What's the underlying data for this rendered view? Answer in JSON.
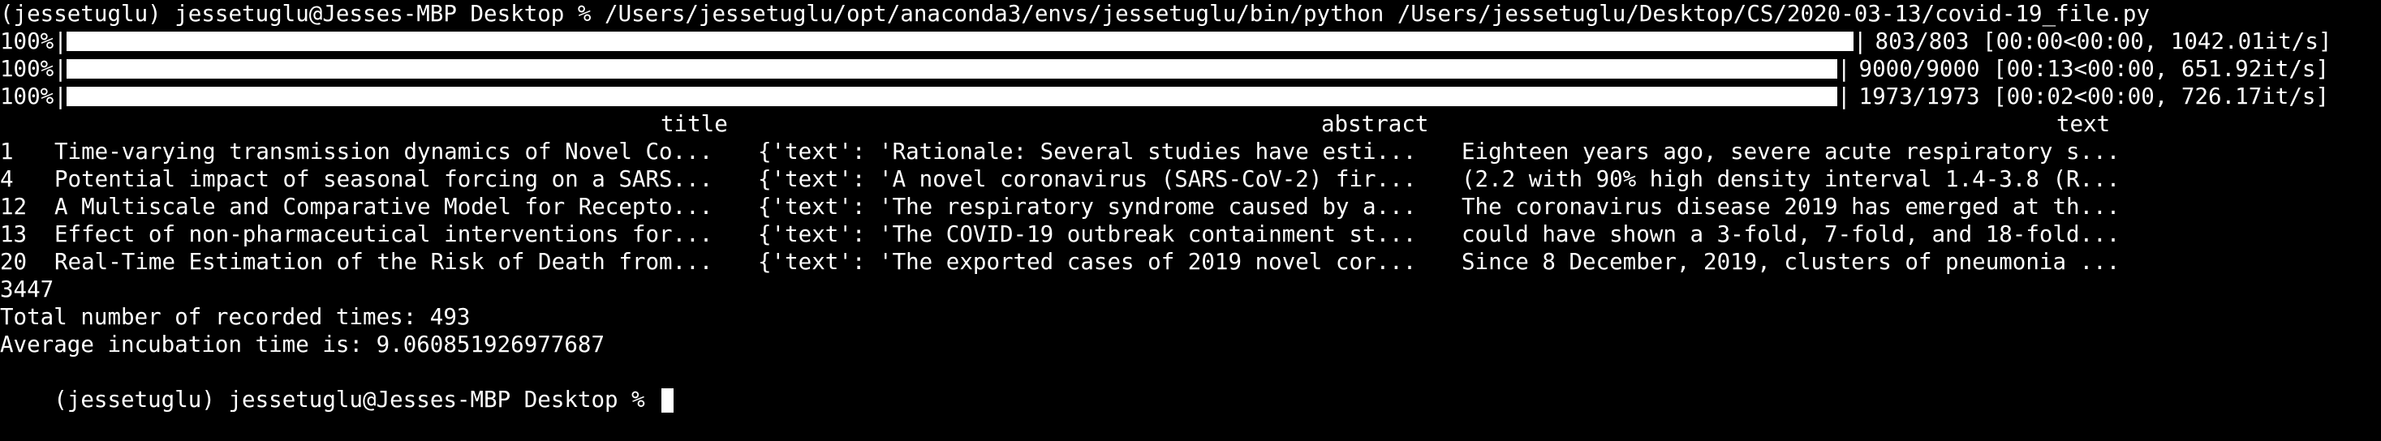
{
  "command_line": "(jessetuglu) jessetuglu@Jesses-MBP Desktop % /Users/jessetuglu/opt/anaconda3/envs/jessetuglu/bin/python /Users/jessetuglu/Desktop/CS/2020-03-13/covid-19_file.py",
  "progress_bars": [
    {
      "percent_label": "100%|",
      "fraction": 1.0,
      "end_char": "|",
      "stats": " 803/803 [00:00<00:00, 1042.01it/s]"
    },
    {
      "percent_label": "100%|",
      "fraction": 1.0,
      "end_char": "|",
      "stats": " 9000/9000 [00:13<00:00, 651.92it/s]"
    },
    {
      "percent_label": "100%|",
      "fraction": 1.0,
      "end_char": "|",
      "stats": " 1973/1973 [00:02<00:00, 726.17it/s]"
    }
  ],
  "table": {
    "headers": [
      "title",
      "abstract",
      "text"
    ],
    "rows": [
      {
        "index": "1",
        "title": "Time-varying transmission dynamics of Novel Co...",
        "abstract": "{'text': 'Rationale: Several studies have esti...",
        "text": "Eighteen years ago, severe acute respiratory s..."
      },
      {
        "index": "4",
        "title": "Potential impact of seasonal forcing on a SARS...",
        "abstract": "{'text': 'A novel coronavirus (SARS-CoV-2) fir...",
        "text": "(2.2 with 90% high density interval 1.4-3.8 (R..."
      },
      {
        "index": "12",
        "title": "A Multiscale and Comparative Model for Recepto...",
        "abstract": "{'text': 'The respiratory syndrome caused by a...",
        "text": "The coronavirus disease 2019 has emerged at th..."
      },
      {
        "index": "13",
        "title": "Effect of non-pharmaceutical interventions for...",
        "abstract": "{'text': 'The COVID-19 outbreak containment st...",
        "text": "could have shown a 3-fold, 7-fold, and 18-fold..."
      },
      {
        "index": "20",
        "title": "Real-Time Estimation of the Risk of Death from...",
        "abstract": "{'text': 'The exported cases of 2019 novel cor...",
        "text": "Since 8 December, 2019, clusters of pneumonia ..."
      }
    ]
  },
  "output_lines": [
    "3447",
    "Total number of recorded times: 493",
    "Average incubation time is: 9.060851926977687"
  ],
  "prompt": "(jessetuglu) jessetuglu@Jesses-MBP Desktop % ",
  "colors": {
    "background": "#000000",
    "foreground": "#ffffff"
  }
}
